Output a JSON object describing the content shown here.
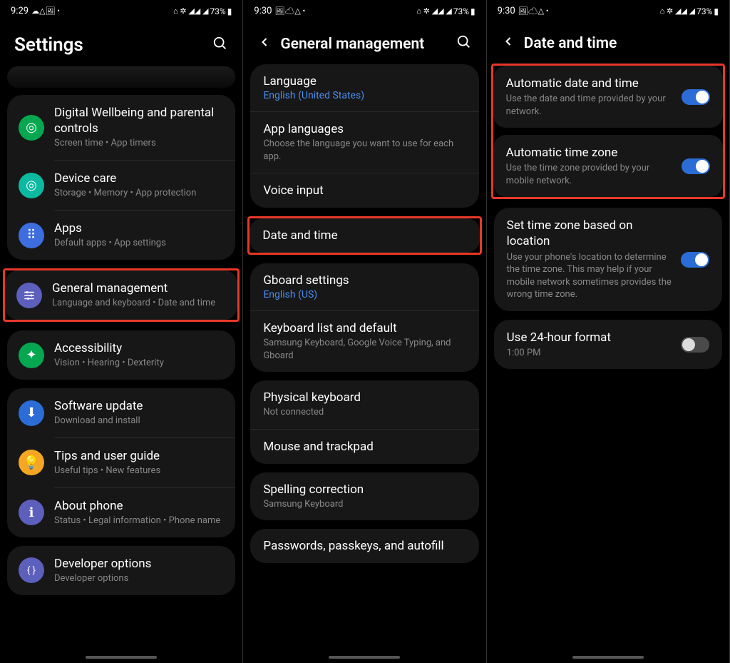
{
  "status": {
    "time1": "9:29",
    "time2": "9:30",
    "time3": "9:30",
    "left_icons": "☁△🖼 •",
    "right_icons": "⌂ ✲ 📶📶 📶 73%▮",
    "battery": "73%"
  },
  "screen1": {
    "title": "Settings",
    "items": [
      {
        "title": "Digital Wellbeing and parental controls",
        "sub": "Screen time  •  App timers",
        "icon": "◎"
      },
      {
        "title": "Device care",
        "sub": "Storage  •  Memory  •  App protection",
        "icon": "◎"
      },
      {
        "title": "Apps",
        "sub": "Default apps  •  App settings",
        "icon": "⊞"
      },
      {
        "title": "General management",
        "sub": "Language and keyboard  •  Date and time",
        "icon": "≡"
      },
      {
        "title": "Accessibility",
        "sub": "Vision  •  Hearing  •  Dexterity",
        "icon": "✦"
      },
      {
        "title": "Software update",
        "sub": "Download and install",
        "icon": "⬇"
      },
      {
        "title": "Tips and user guide",
        "sub": "Useful tips  •  New features",
        "icon": "💡"
      },
      {
        "title": "About phone",
        "sub": "Status  •  Legal information  •  Phone name",
        "icon": "ℹ"
      },
      {
        "title": "Developer options",
        "sub": "Developer options",
        "icon": "{ }"
      }
    ]
  },
  "screen2": {
    "title": "General management",
    "items": [
      {
        "title": "Language",
        "sub": "English (United States)",
        "blue": true
      },
      {
        "title": "App languages",
        "sub": "Choose the language you want to use for each app."
      },
      {
        "title": "Voice input",
        "sub": ""
      },
      {
        "title": "Date and time",
        "sub": "",
        "highlight": true
      },
      {
        "title": "Gboard settings",
        "sub": "English (US)",
        "blue": true
      },
      {
        "title": "Keyboard list and default",
        "sub": "Samsung Keyboard, Google Voice Typing, and Gboard"
      },
      {
        "title": "Physical keyboard",
        "sub": "Not connected"
      },
      {
        "title": "Mouse and trackpad",
        "sub": ""
      },
      {
        "title": "Spelling correction",
        "sub": "Samsung Keyboard"
      },
      {
        "title": "Passwords, passkeys, and autofill",
        "sub": ""
      }
    ]
  },
  "screen3": {
    "title": "Date and time",
    "items": [
      {
        "title": "Automatic date and time",
        "sub": "Use the date and time provided by your network.",
        "toggle": true
      },
      {
        "title": "Automatic time zone",
        "sub": "Use the time zone provided by your mobile network.",
        "toggle": true
      },
      {
        "title": "Set time zone based on location",
        "sub": "Use your phone's location to determine the time zone. This may help if your mobile network sometimes provides the wrong time zone.",
        "toggle": true
      },
      {
        "title": "Use 24-hour format",
        "sub": "1:00 PM",
        "toggle": false
      }
    ]
  }
}
